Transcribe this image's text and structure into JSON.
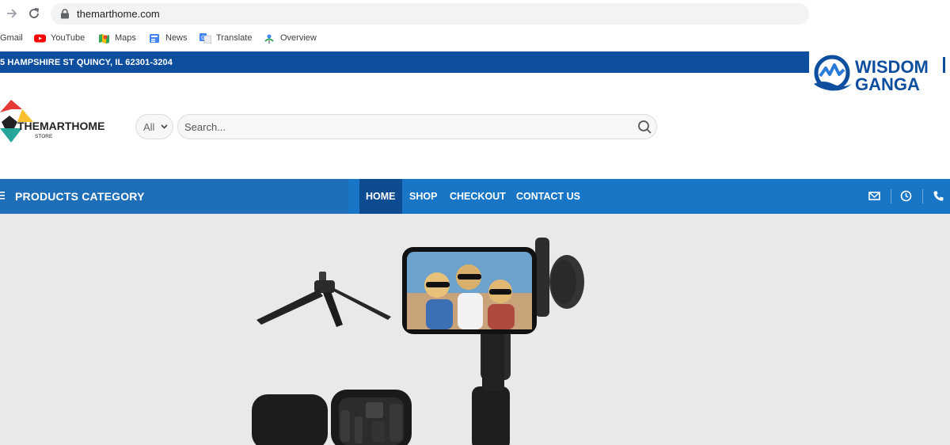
{
  "browser": {
    "url": "themarthome.com",
    "bookmarks": [
      {
        "label": "Gmail",
        "icon": "gmail-icon"
      },
      {
        "label": "YouTube",
        "icon": "youtube-icon"
      },
      {
        "label": "Maps",
        "icon": "maps-icon"
      },
      {
        "label": "News",
        "icon": "news-icon"
      },
      {
        "label": "Translate",
        "icon": "translate-icon"
      },
      {
        "label": "Overview",
        "icon": "overview-icon"
      }
    ]
  },
  "watermark": {
    "line1": "WISDOM",
    "line2": "GANGA",
    "color": "#0d4f9e"
  },
  "topbar": {
    "address": "5 HAMPSHIRE ST QUINCY, IL 62301-3204",
    "bg": "#0d4f9e"
  },
  "header": {
    "logo_text": "THEMARTHOME",
    "logo_sub": "STORE",
    "category_select": "All",
    "search_placeholder": "Search..."
  },
  "navbar": {
    "category_label": "PRODUCTS CATEGORY",
    "menu": [
      {
        "label": "HOME",
        "active": true
      },
      {
        "label": "SHOP",
        "active": false
      },
      {
        "label": "CHECKOUT",
        "active": false
      },
      {
        "label": "CONTACT US",
        "active": false
      }
    ],
    "icons": [
      "mail-icon",
      "clock-icon",
      "phone-icon"
    ],
    "bg": "#1976c6",
    "active_bg": "#0e4c92"
  },
  "hero": {
    "product": "phone-gimbal-stabilizer-kit",
    "bg": "#e9e9e9"
  }
}
